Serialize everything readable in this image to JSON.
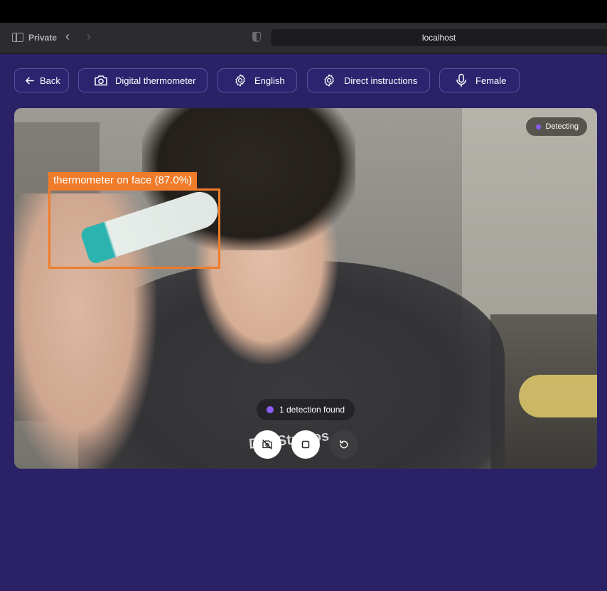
{
  "browser": {
    "private_label": "Private",
    "url": "localhost"
  },
  "toolbar": {
    "back_label": "Back",
    "device_label": "Digital thermometer",
    "language_label": "English",
    "instructions_label": "Direct instructions",
    "voice_label": "Female"
  },
  "camera": {
    "status_label": "Detecting",
    "detection_label": "thermometer on face (87.0%)",
    "detection_summary": "1 detection found",
    "shirt_text": "DAI Studios"
  },
  "colors": {
    "background": "#2a2167",
    "bbox": "#f07c2a",
    "status_dot": "#8b5cf6"
  },
  "icons": [
    "sidebar-icon",
    "chevron-left-icon",
    "chevron-right-icon",
    "shield-icon",
    "arrow-left-icon",
    "camera-icon",
    "gear-icon",
    "microphone-icon",
    "camera-off-icon",
    "stop-icon",
    "refresh-icon"
  ]
}
